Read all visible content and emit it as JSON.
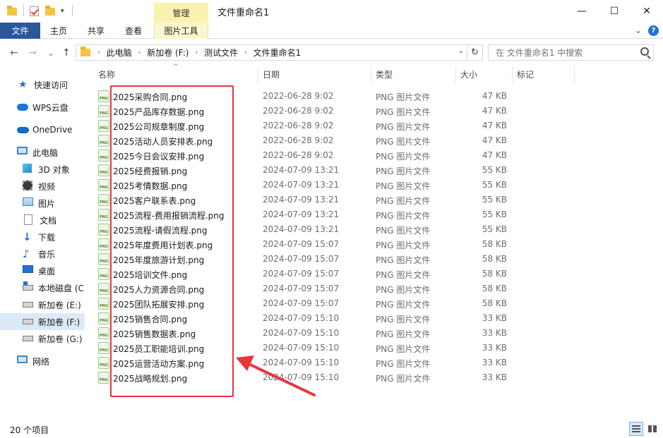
{
  "window": {
    "title": "文件重命名1",
    "context_tab": "管理",
    "controls": {
      "minimize": "—",
      "maximize": "☐",
      "close": "✕"
    }
  },
  "ribbon": {
    "tabs": [
      {
        "label": "文件",
        "active": true
      },
      {
        "label": "主页"
      },
      {
        "label": "共享"
      },
      {
        "label": "查看"
      },
      {
        "label": "图片工具"
      }
    ],
    "collapse_glyph": "⌄",
    "help_glyph": "?"
  },
  "nav": {
    "back_glyph": "←",
    "forward_glyph": "→",
    "recent_glyph": "⌄",
    "up_glyph": "↑",
    "breadcrumb": [
      "此电脑",
      "新加卷 (F:)",
      "测试文件",
      "文件重命名1"
    ],
    "breadcrumb_sep": "›",
    "dropdown_glyph": "⌄",
    "refresh_glyph": "↻",
    "search_placeholder": "在 文件重命名1 中搜索"
  },
  "sidebar": {
    "items": [
      {
        "label": "快速访问",
        "icon": "star-icon"
      },
      {
        "label": "WPS云盘",
        "icon": "wps-cloud-icon"
      },
      {
        "label": "OneDrive",
        "icon": "onedrive-icon"
      },
      {
        "label": "此电脑",
        "icon": "this-pc-icon"
      },
      {
        "label": "3D 对象",
        "icon": "3d-objects-icon"
      },
      {
        "label": "视频",
        "icon": "video-icon"
      },
      {
        "label": "图片",
        "icon": "pictures-icon"
      },
      {
        "label": "文档",
        "icon": "documents-icon"
      },
      {
        "label": "下载",
        "icon": "downloads-icon"
      },
      {
        "label": "音乐",
        "icon": "music-icon"
      },
      {
        "label": "桌面",
        "icon": "desktop-icon"
      },
      {
        "label": "本地磁盘 (C",
        "icon": "local-disk-icon"
      },
      {
        "label": "新加卷 (E:)",
        "icon": "drive-icon"
      },
      {
        "label": "新加卷 (F:)",
        "icon": "drive-icon",
        "selected": true
      },
      {
        "label": "新加卷 (G:)",
        "icon": "drive-icon"
      },
      {
        "label": "网络",
        "icon": "network-icon"
      }
    ]
  },
  "columns": {
    "name": "名称",
    "date": "日期",
    "type": "类型",
    "size": "大小",
    "tags": "标记",
    "sort_glyph": "^"
  },
  "files": [
    {
      "name": "2025采购合同.png",
      "date": "2022-06-28 9:02",
      "type": "PNG 图片文件",
      "size": "47 KB"
    },
    {
      "name": "2025产品库存数据.png",
      "date": "2022-06-28 9:02",
      "type": "PNG 图片文件",
      "size": "47 KB"
    },
    {
      "name": "2025公司规章制度.png",
      "date": "2022-06-28 9:02",
      "type": "PNG 图片文件",
      "size": "47 KB"
    },
    {
      "name": "2025活动人员安排表.png",
      "date": "2022-06-28 9:02",
      "type": "PNG 图片文件",
      "size": "47 KB"
    },
    {
      "name": "2025今日会议安排.png",
      "date": "2022-06-28 9:02",
      "type": "PNG 图片文件",
      "size": "47 KB"
    },
    {
      "name": "2025经费报销.png",
      "date": "2024-07-09 13:21",
      "type": "PNG 图片文件",
      "size": "55 KB"
    },
    {
      "name": "2025考情数据.png",
      "date": "2024-07-09 13:21",
      "type": "PNG 图片文件",
      "size": "55 KB"
    },
    {
      "name": "2025客户联系表.png",
      "date": "2024-07-09 13:21",
      "type": "PNG 图片文件",
      "size": "55 KB"
    },
    {
      "name": "2025流程-费用报销流程.png",
      "date": "2024-07-09 13:21",
      "type": "PNG 图片文件",
      "size": "55 KB"
    },
    {
      "name": "2025流程-请假流程.png",
      "date": "2024-07-09 13:21",
      "type": "PNG 图片文件",
      "size": "55 KB"
    },
    {
      "name": "2025年度费用计划表.png",
      "date": "2024-07-09 15:07",
      "type": "PNG 图片文件",
      "size": "58 KB"
    },
    {
      "name": "2025年度旅游计划.png",
      "date": "2024-07-09 15:07",
      "type": "PNG 图片文件",
      "size": "58 KB"
    },
    {
      "name": "2025培训文件.png",
      "date": "2024-07-09 15:07",
      "type": "PNG 图片文件",
      "size": "58 KB"
    },
    {
      "name": "2025人力资源合同.png",
      "date": "2024-07-09 15:07",
      "type": "PNG 图片文件",
      "size": "58 KB"
    },
    {
      "name": "2025团队拓展安排.png",
      "date": "2024-07-09 15:07",
      "type": "PNG 图片文件",
      "size": "58 KB"
    },
    {
      "name": "2025销售合同.png",
      "date": "2024-07-09 15:10",
      "type": "PNG 图片文件",
      "size": "33 KB"
    },
    {
      "name": "2025销售数据表.png",
      "date": "2024-07-09 15:10",
      "type": "PNG 图片文件",
      "size": "33 KB"
    },
    {
      "name": "2025员工职能培训.png",
      "date": "2024-07-09 15:10",
      "type": "PNG 图片文件",
      "size": "33 KB"
    },
    {
      "name": "2025运营活动方案.png",
      "date": "2024-07-09 15:10",
      "type": "PNG 图片文件",
      "size": "33 KB"
    },
    {
      "name": "2025战略规划.png",
      "date": "2024-07-09 15:10",
      "type": "PNG 图片文件",
      "size": "33 KB"
    }
  ],
  "file_icon_text": "PNG",
  "status": {
    "item_count": "20 个项目"
  },
  "colors": {
    "file_tab": "#2a579a",
    "context_tab": "#fbf2b0",
    "selection": "#dce9f7",
    "annotation": "#e8343b"
  }
}
